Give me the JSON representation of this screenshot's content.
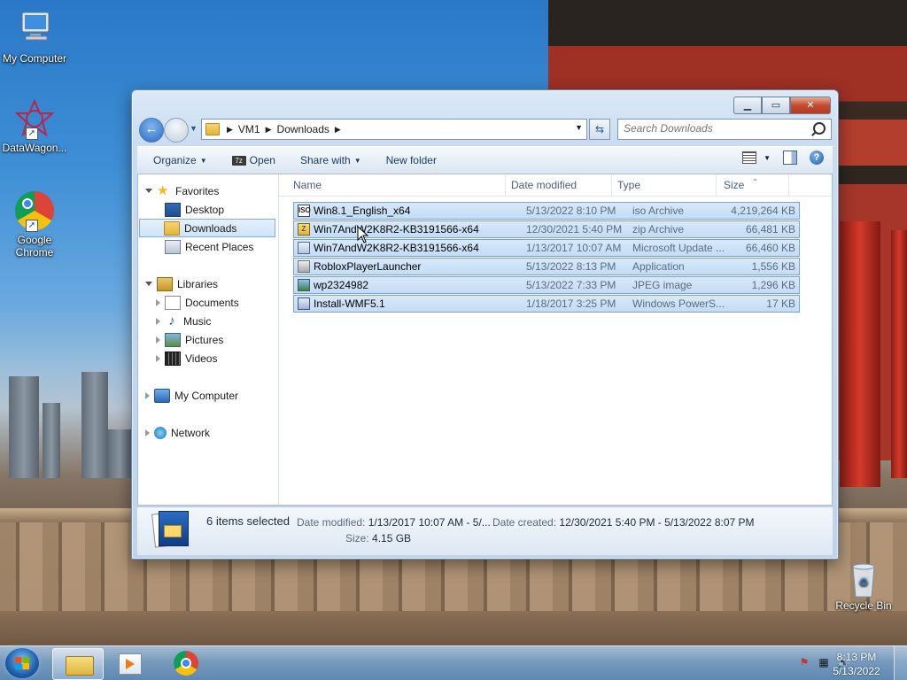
{
  "desktop": {
    "icons": [
      {
        "label": "My Computer",
        "icon": "computer-icon"
      },
      {
        "label": "DataWagon...",
        "icon": "datawagon-icon"
      },
      {
        "label": "Google Chrome",
        "icon": "chrome-icon"
      },
      {
        "label": "Recycle Bin",
        "icon": "recycle-bin-icon"
      }
    ]
  },
  "window": {
    "breadcrumb": [
      "VM1",
      "Downloads"
    ],
    "search_placeholder": "Search Downloads",
    "toolbar": {
      "organize": "Organize",
      "open": "Open",
      "open_badge": "7z",
      "share_with": "Share with",
      "new_folder": "New folder"
    },
    "nav": {
      "favorites": "Favorites",
      "desktop": "Desktop",
      "downloads": "Downloads",
      "recent_places": "Recent Places",
      "libraries": "Libraries",
      "documents": "Documents",
      "music": "Music",
      "pictures": "Pictures",
      "videos": "Videos",
      "my_computer": "My Computer",
      "network": "Network"
    },
    "columns": {
      "name": "Name",
      "date": "Date modified",
      "type": "Type",
      "size": "Size"
    },
    "files": [
      {
        "name": "Win8.1_English_x64",
        "date": "5/13/2022 8:10 PM",
        "type": "iso Archive",
        "size": "4,219,264 KB",
        "icon": "iso-file-icon",
        "badge": "ISO"
      },
      {
        "name": "Win7AndW2K8R2-KB3191566-x64",
        "date": "12/30/2021 5:40 PM",
        "type": "zip Archive",
        "size": "66,481 KB",
        "icon": "zip-file-icon",
        "badge": "Z"
      },
      {
        "name": "Win7AndW2K8R2-KB3191566-x64",
        "date": "1/13/2017 10:07 AM",
        "type": "Microsoft Update ...",
        "size": "66,460 KB",
        "icon": "msu-file-icon",
        "badge": ""
      },
      {
        "name": "RobloxPlayerLauncher",
        "date": "5/13/2022 8:13 PM",
        "type": "Application",
        "size": "1,556 KB",
        "icon": "application-icon",
        "badge": ""
      },
      {
        "name": "wp2324982",
        "date": "5/13/2022 7:33 PM",
        "type": "JPEG image",
        "size": "1,296 KB",
        "icon": "jpeg-file-icon",
        "badge": ""
      },
      {
        "name": "Install-WMF5.1",
        "date": "1/18/2017 3:25 PM",
        "type": "Windows PowerS...",
        "size": "17 KB",
        "icon": "powershell-file-icon",
        "badge": ""
      }
    ],
    "details": {
      "count": "6 items selected",
      "modified_label": "Date modified:",
      "modified_value": "1/13/2017 10:07 AM - 5/...",
      "created_label": "Date created:",
      "created_value": "12/30/2021 5:40 PM - 5/13/2022 8:07 PM",
      "size_label": "Size:",
      "size_value": "4.15 GB"
    }
  },
  "taskbar": {
    "time": "8:13 PM",
    "date": "5/13/2022"
  }
}
